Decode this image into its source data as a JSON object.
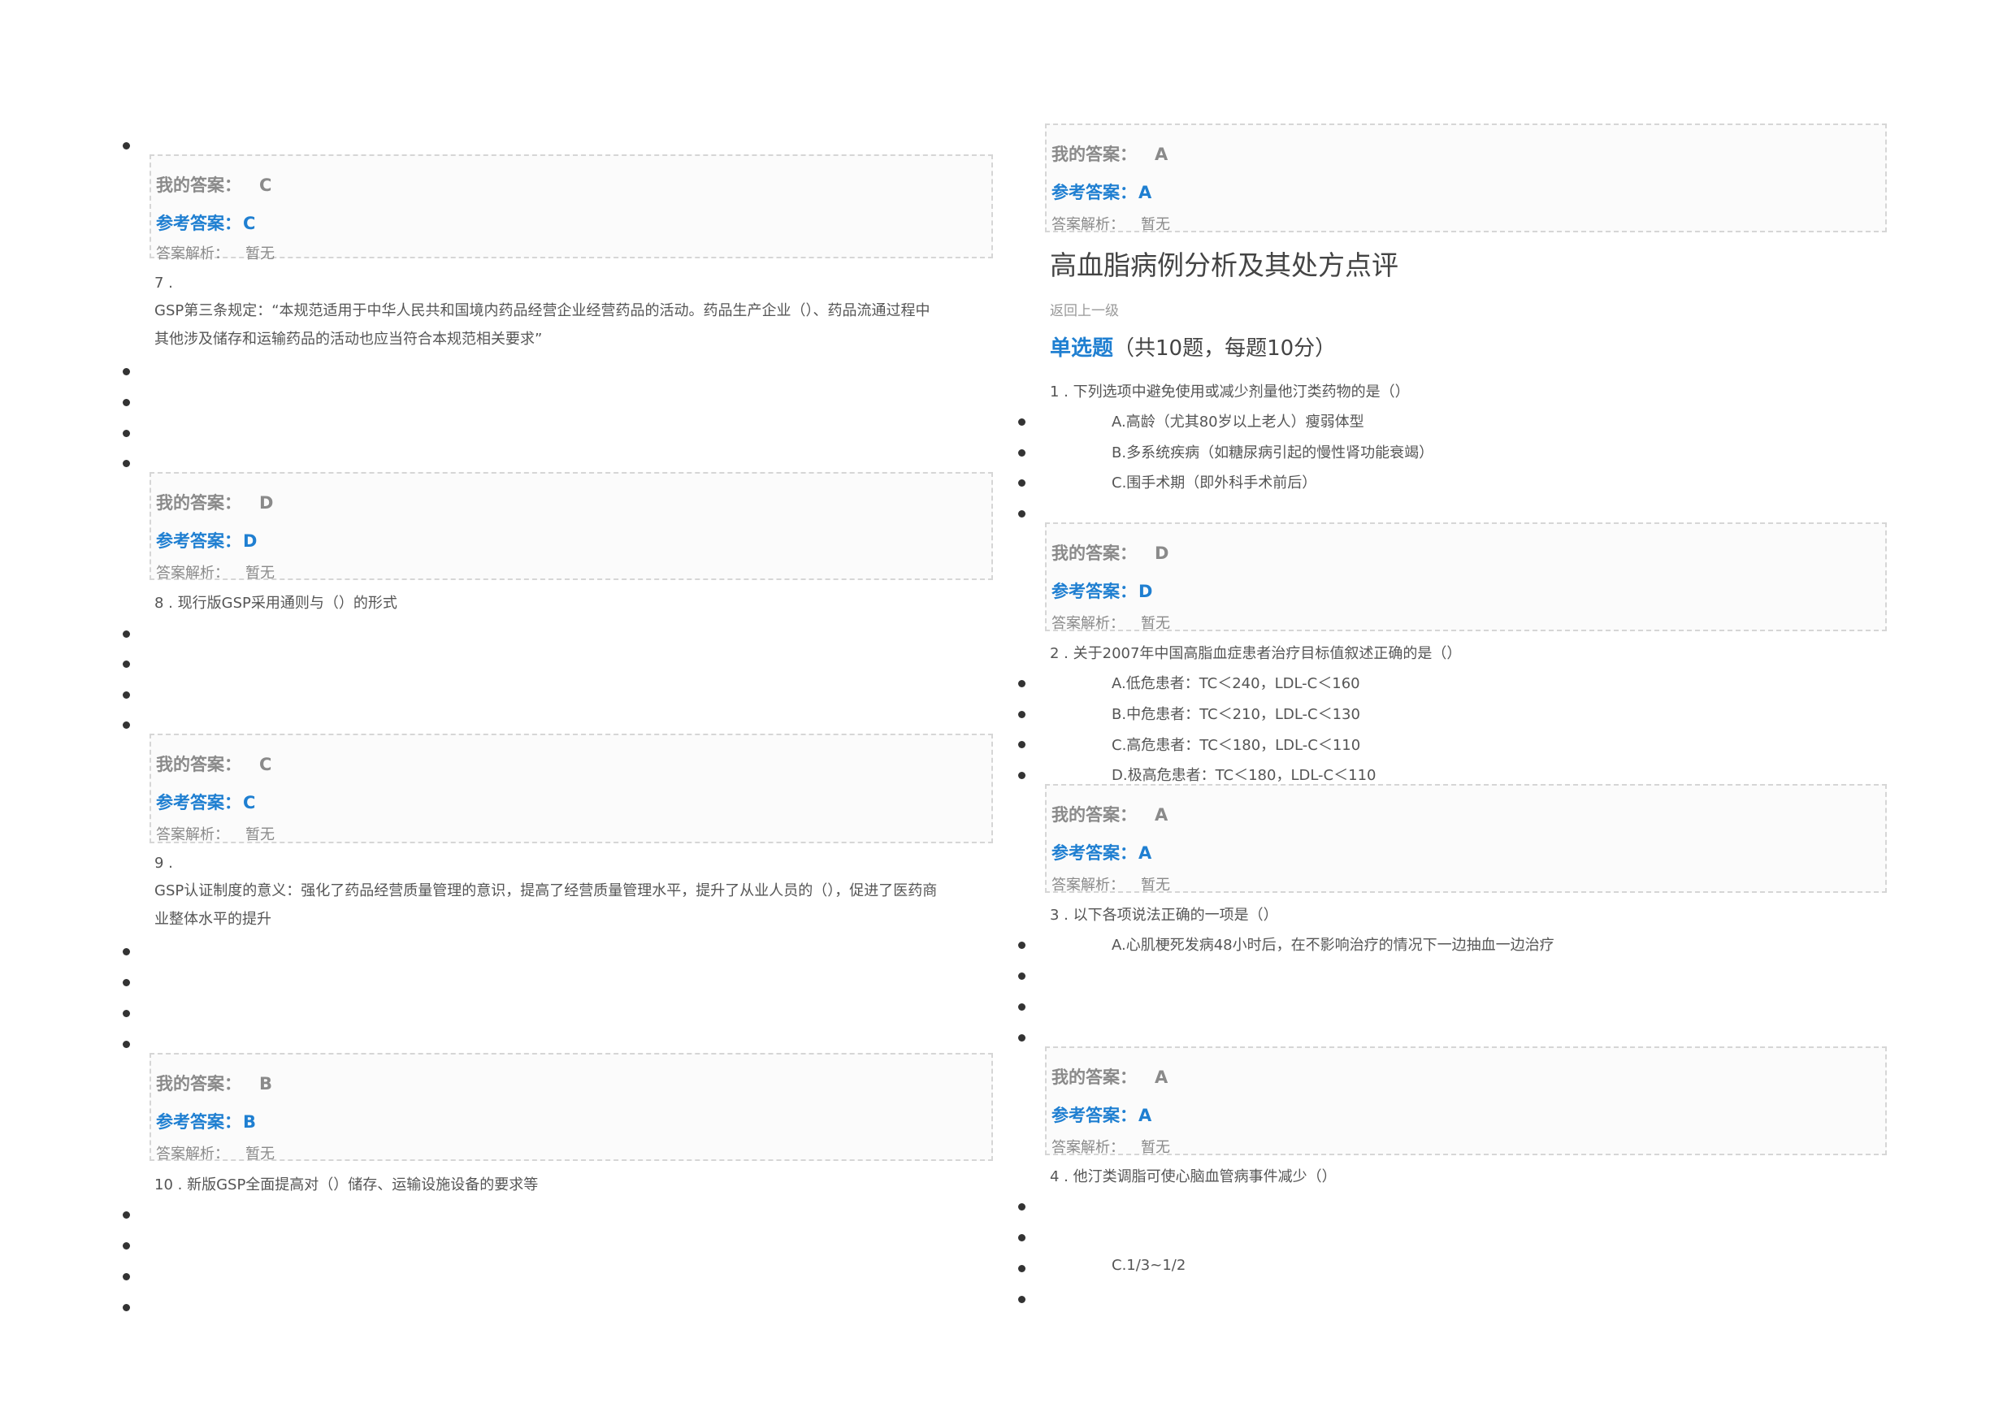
{
  "labels": {
    "my_answer": "我的答案：",
    "ref_answer": "参考答案：",
    "analysis": "答案解析：",
    "analysis_value": "暂无"
  },
  "left": {
    "box1": {
      "my": "C",
      "ref": "C"
    },
    "q7": {
      "num": "7 .",
      "text_line1": "GSP第三条规定：“本规范适用于中华人民共和国境内药品经营企业经营药品的活动。药品生产企业（）、药品流通过程中",
      "text_line2": "其他涉及储存和运输药品的活动也应当符合本规范相关要求”"
    },
    "box2": {
      "my": "D",
      "ref": "D"
    },
    "q8": {
      "text": "8 . 现行版GSP采用通则与（）的形式"
    },
    "box3": {
      "my": "C",
      "ref": "C"
    },
    "q9": {
      "num": "9 .",
      "text_line1": "GSP认证制度的意义：强化了药品经营质量管理的意识，提高了经营质量管理水平，提升了从业人员的（），促进了医药商",
      "text_line2": "业整体水平的提升"
    },
    "box4": {
      "my": "B",
      "ref": "B"
    },
    "q10": {
      "text": "10 . 新版GSP全面提高对（）储存、运输设施设备的要求等"
    }
  },
  "right": {
    "box0": {
      "my": "A",
      "ref": "A"
    },
    "section_title": "高血脂病例分析及其处方点评",
    "back_link": "返回上一级",
    "qtype": {
      "strong": "单选题",
      "rest": "（共10题，每题10分）"
    },
    "q1": {
      "text": "1 . 下列选项中避免使用或减少剂量他汀类药物的是（）",
      "options": [
        "A.高龄（尤其80岁以上老人）瘦弱体型",
        "B.多系统疾病（如糖尿病引起的慢性肾功能衰竭）",
        "C.围手术期（即外科手术前后）"
      ]
    },
    "box1": {
      "my": "D",
      "ref": "D"
    },
    "q2": {
      "text": "2 . 关于2007年中国高脂血症患者治疗目标值叙述正确的是（）",
      "options": [
        "A.低危患者：TC＜240，LDL-C＜160",
        "B.中危患者：TC＜210，LDL-C＜130",
        "C.高危患者：TC＜180，LDL-C＜110",
        "D.极高危患者：TC＜180，LDL-C＜110"
      ]
    },
    "box2": {
      "my": "A",
      "ref": "A"
    },
    "q3": {
      "text": "3 . 以下各项说法正确的一项是（）",
      "options": [
        "A.心肌梗死发病48小时后，在不影响治疗的情况下一边抽血一边治疗"
      ]
    },
    "box3": {
      "my": "A",
      "ref": "A"
    },
    "q4": {
      "text": "4 . 他汀类调脂可使心脑血管病事件减少（）",
      "options": [
        "C.1/3~1/2"
      ]
    }
  }
}
